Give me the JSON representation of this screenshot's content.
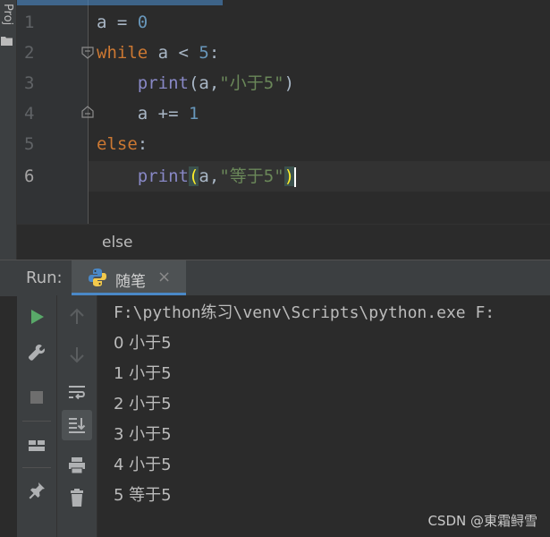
{
  "project_strip": {
    "tab_label": "Proj"
  },
  "editor": {
    "line_numbers": [
      "1",
      "2",
      "3",
      "4",
      "5",
      "6"
    ],
    "lines": [
      [
        {
          "t": "a = ",
          "c": "plain"
        },
        {
          "t": "0",
          "c": "num"
        }
      ],
      [
        {
          "t": "while",
          "c": "kw"
        },
        {
          "t": " a < ",
          "c": "plain"
        },
        {
          "t": "5",
          "c": "num"
        },
        {
          "t": ":",
          "c": "plain"
        }
      ],
      [
        {
          "t": "    ",
          "c": "plain"
        },
        {
          "t": "print",
          "c": "fn"
        },
        {
          "t": "(a,",
          "c": "plain"
        },
        {
          "t": "\"小于5\"",
          "c": "str"
        },
        {
          "t": ")",
          "c": "plain"
        }
      ],
      [
        {
          "t": "    a += ",
          "c": "plain"
        },
        {
          "t": "1",
          "c": "num"
        }
      ],
      [
        {
          "t": "else",
          "c": "kw"
        },
        {
          "t": ":",
          "c": "plain"
        }
      ],
      [
        {
          "t": "    ",
          "c": "plain"
        },
        {
          "t": "print",
          "c": "fn"
        },
        {
          "t": "(",
          "c": "paren-hl"
        },
        {
          "t": "a,",
          "c": "plain"
        },
        {
          "t": "\"等于5\"",
          "c": "str"
        },
        {
          "t": ")",
          "c": "paren-hl"
        }
      ]
    ],
    "current_line": 6
  },
  "breadcrumb": {
    "text": "else"
  },
  "run_panel": {
    "label": "Run:",
    "tab_name": "随笔",
    "tab_close": "×"
  },
  "console": {
    "lines": [
      "F:\\python练习\\venv\\Scripts\\python.exe F:",
      "0 小于5",
      "1 小于5",
      "2 小于5",
      "3 小于5",
      "4 小于5",
      "5 等于5"
    ]
  },
  "watermark": {
    "text": "CSDN @東霜鲟雪"
  },
  "colors": {
    "keyword": "#cc7832",
    "number": "#6897bb",
    "string": "#6a8759",
    "builtin": "#8888c6",
    "run_green": "#59a869",
    "accent_blue": "#4a88c7"
  }
}
